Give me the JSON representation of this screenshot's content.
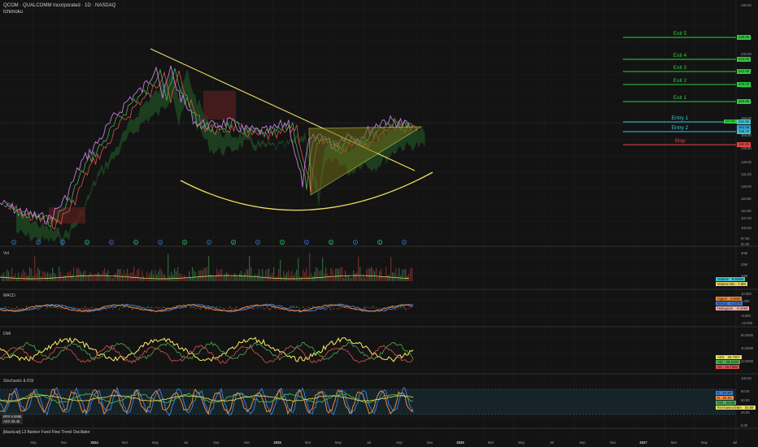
{
  "header": {
    "title": "QCOM · QUALCOMM Incorporated · 1D · NASDAQ",
    "indicator": "Ichimoku"
  },
  "colors": {
    "bg": "#131313",
    "grid": "#1e1e1e",
    "exit": "#2ecc40",
    "entry": "#3ec6d9",
    "stop": "#e84545",
    "yellow": "#f0e060",
    "violet": "#c57de0",
    "green": "#4caf50",
    "red": "#e05050",
    "blue": "#3a7bd5",
    "orange": "#f08a3a"
  },
  "levels": {
    "exits": [
      "Exit 5",
      "Exit 4",
      "Exit 3",
      "Exit 2",
      "Exit 1"
    ],
    "entries": [
      "Entry 1",
      "Entry 2"
    ],
    "stop": "Stop"
  },
  "price_axis": [
    "290.00",
    "250.00",
    "230.00",
    "210.00",
    "190.00",
    "178.00",
    "166.00",
    "154.00",
    "146.50",
    "139.00",
    "131.00",
    "125.00",
    "119.00",
    "113.00",
    "107.00",
    "102.00",
    "97.00",
    "92.00"
  ],
  "price_boxes": {
    "exit5": "238.00",
    "exit4": "224.00",
    "exit3": "212.00",
    "exit2": "200.00",
    "exit1": "184.55",
    "current": "161.08",
    "entry1": "161.50",
    "entry2": "156.20",
    "stop": "150.00",
    "qcom_tag": "QCOM"
  },
  "volume": {
    "label": "Vol",
    "axis": [
      "30M",
      "20M",
      "10M"
    ],
    "legend": [
      [
        "Volume",
        "8.916M"
      ],
      [
        "Volume MA",
        "7.6M"
      ]
    ]
  },
  "macd": {
    "label": "MACD",
    "axis": [
      "10.000",
      "5.000",
      "0.000",
      "-5.000",
      "-10.000"
    ],
    "legend": [
      [
        "Signal",
        "0.6669"
      ],
      [
        "MACD",
        "0.2379"
      ],
      [
        "Histogram",
        "-0.4059"
      ]
    ]
  },
  "dmi": {
    "label": "DMI",
    "axis": [
      "60.0000",
      "40.0000",
      "20.0000"
    ],
    "legend": [
      [
        "ADX",
        "26.7007"
      ],
      [
        "+DI",
        "28.2100"
      ],
      [
        "-DI",
        "19.7393"
      ]
    ]
  },
  "stoch": {
    "label": "Stochastic & RSI",
    "axis": [
      "100.00",
      "80.00",
      "60.00",
      "20.00",
      "0.00"
    ],
    "legend": [
      [
        "K",
        "67.97"
      ],
      [
        "D",
        "61.81"
      ],
      [
        "RSI",
        "56.55"
      ],
      [
        "RSI-based EMA",
        "50.89"
      ]
    ],
    "side_tags": [
      "BFR 6.5956",
      "ADX 28.46"
    ]
  },
  "bottom_indicator": "[blackcat] L3 Banker Fund Flow Trend Oscillator",
  "time_axis": [
    "Sep",
    "Nov",
    "2024",
    "Mar",
    "May",
    "Jul",
    "Sep",
    "Nov",
    "2025",
    "Mar",
    "May",
    "Jul",
    "Sep",
    "Nov",
    "2026",
    "Mar",
    "May",
    "Jul",
    "Sep",
    "Nov",
    "2027",
    "Mar",
    "May",
    "Jul"
  ],
  "event_badges": [
    "D",
    "D",
    "D",
    "E",
    "D",
    "E",
    "D",
    "E",
    "D",
    "E",
    "D",
    "E",
    "D",
    "E",
    "D",
    "E",
    "D"
  ]
}
